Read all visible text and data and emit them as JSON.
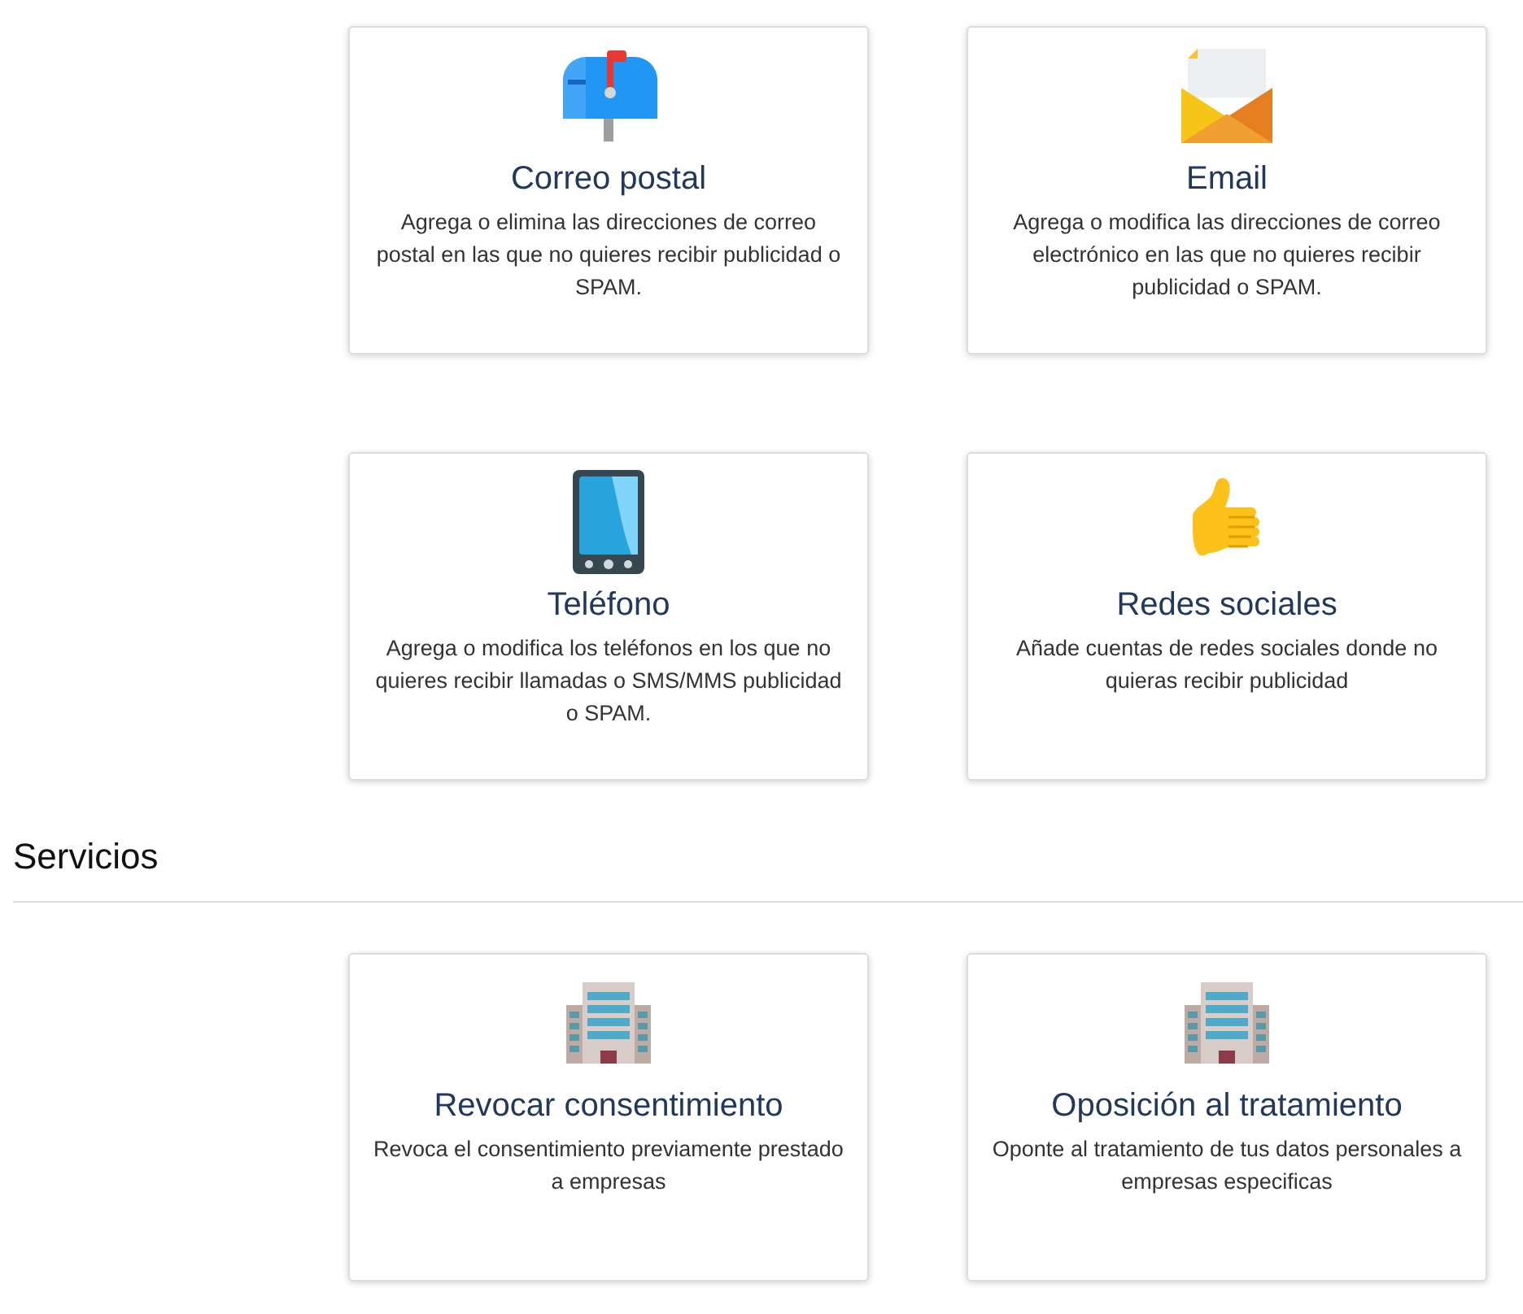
{
  "contact_cards": [
    {
      "kind": "mailbox",
      "title": "Correo postal",
      "description": "Agrega o elimina las direcciones de correo postal en las que no quieres recibir publicidad o SPAM."
    },
    {
      "kind": "envelope",
      "title": "Email",
      "description": "Agrega o modifica las direcciones de correo electrónico en las que no quieres recibir publicidad o SPAM."
    },
    {
      "kind": "phone",
      "title": "Teléfono",
      "description": "Agrega o modifica los teléfonos en los que no quieres recibir llamadas o SMS/MMS publicidad o SPAM."
    },
    {
      "kind": "thumb",
      "title": "Redes sociales",
      "description": "Añade cuentas de redes sociales donde no quieras recibir publicidad"
    }
  ],
  "services": {
    "title": "Servicios",
    "cards": [
      {
        "kind": "building",
        "title": "Revocar consentimiento",
        "description": "Revoca el consentimiento previamente prestado a empresas"
      },
      {
        "kind": "building",
        "title": "Oposición al tratamiento",
        "description": "Oponte al tratamiento de tus datos personales a empresas especificas"
      }
    ]
  }
}
